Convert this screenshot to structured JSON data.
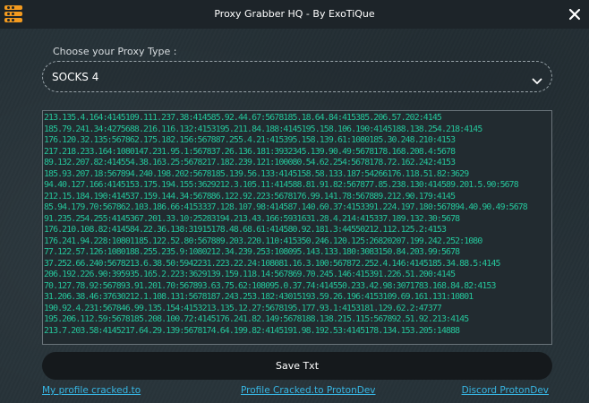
{
  "window": {
    "title": "Proxy Grabber HQ - By ExoTiQue"
  },
  "proxy_type": {
    "label": "Choose your Proxy Type :",
    "selected": "SOCKS 4"
  },
  "proxy_list": [
    "213.135.4.164:4145109.111.237.38:414585.92.44.67:5678185.18.64.84:415385.206.57.202:4145",
    "185.79.241.34:4275688.216.116.132:4153195.211.84.188:4145195.158.106.190:4145188.138.254.218:4145",
    "176.120.32.135:567862.175.182.156:567887.255.4.21:415395.158.139.61:1080185.30.248.210:4153",
    "217.218.233.164:1080147.231.95.1:567837.26.136.181:3932345.139.90.49:5678178.168.208.4:5678",
    "89.132.207.82:414554.38.163.25:5678217.182.239.121:100080.54.62.254:5678178.72.162.242:4153",
    "185.93.207.18:567894.240.198.202:5678185.139.56.133:4145158.58.133.187:54266176.118.51.82:3629",
    "94.40.127.166:4145153.175.194.155:3629212.3.105.11:414588.81.91.82:567877.85.238.130:414589.201.5.90:5678",
    "212.15.184.190:414537.159.144.34:567886.122.92.223:5678176.99.141.78:567889.212.90.179:4145",
    "85.94.179.70:567862.103.186.66:4153337.128.107.98:414587.140.60.37:4153391.224.197.180:567894.40.90.49:5678",
    "91.235.254.255:4145367.201.33.10:25283194.213.43.166:5931631.28.4.214:415337.189.132.30:5678",
    "176.210.108.82:414584.22.36.138:31915178.48.68.61:414580.92.181.3:44550212.112.125.2:4153",
    "176.241.94.228:10801185.122.52.80:567889.203.220.110:415350.246.120.125:26820207.199.242.252:1080",
    "77.122.57.126:1080188.255.235.9:1080212.34.239.253:108095.143.133.180:3083150.84.203.99:5678",
    "37.252.66.240:5678213.6.38.50:5942231.223.22.24:108081.16.3.100:567872.252.4.146:4145185.34.88.5:4145",
    "206.192.226.90:395935.165.2.223:3629139.159.118.14:567869.70.245.146:415391.226.51.200:4145",
    "70.127.78.92:567893.91.201.70:567893.63.75.62:108095.0.37.74:414550.233.42.98:3071783.168.84.82:4153",
    "31.206.38.46:37630212.1.108.131:5678187.243.253.182:43015193.59.26.196:4153109.69.161.131:10801",
    "190.92.4.231:567846.99.135.154:4153213.135.12.27:5678195.177.93.1:4153181.129.62.2:47377",
    "195.206.112.59:5678185.208.100.72:4145176.241.82.149:5678188.138.215.115:567892.51.92.213:4145",
    "213.7.203.58:4145217.64.29.139:5678174.64.199.82:4145191.98.192.53:4145178.134.153.205:14888"
  ],
  "save_button": {
    "label": "Save Txt"
  },
  "footer_links": {
    "left": "My profile cracked.to",
    "center": "Profile Cracked.to ProtonDev",
    "right": "Discord ProtonDev"
  },
  "icons": {
    "app": "hamburger-stack-icon",
    "close": "close-icon",
    "dropdown": "chevron-down-icon"
  },
  "colors": {
    "background": "#263238",
    "titlebar": "#1d2429",
    "accent_orange": "#f39a1f",
    "proxy_text": "#25c49a",
    "link": "#37b6e3",
    "button_bg": "#15191c"
  }
}
